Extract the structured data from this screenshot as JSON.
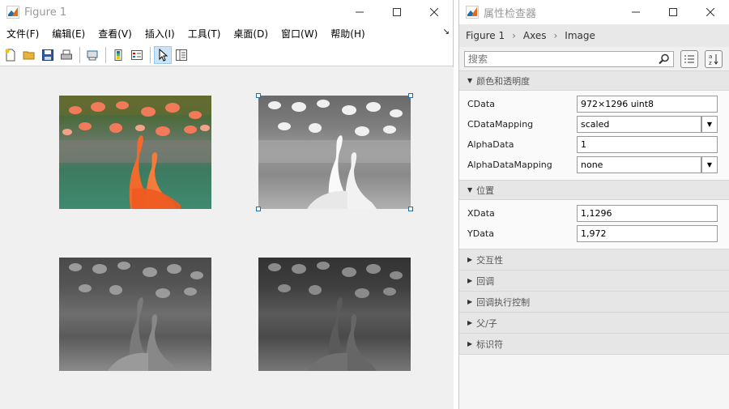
{
  "figure": {
    "title": "Figure 1",
    "menu": [
      "文件(F)",
      "编辑(E)",
      "查看(V)",
      "插入(I)",
      "工具(T)",
      "桌面(D)",
      "窗口(W)",
      "帮助(H)"
    ],
    "dock_glyph": "↘"
  },
  "inspector": {
    "title": "属性检查器",
    "breadcrumbs": [
      "Figure 1",
      "Axes",
      "Image"
    ],
    "search_placeholder": "搜索",
    "sections": {
      "color": "颜色和透明度",
      "position": "位置",
      "interactivity": "交互性",
      "callbacks": "回调",
      "callback_exec": "回调执行控制",
      "parent": "父/子",
      "identifiers": "标识符"
    },
    "props": {
      "cdata": {
        "label": "CData",
        "value": "972×1296 uint8"
      },
      "cdatamapping": {
        "label": "CDataMapping",
        "value": "scaled"
      },
      "alphadata": {
        "label": "AlphaData",
        "value": "1"
      },
      "alphadatamapping": {
        "label": "AlphaDataMapping",
        "value": "none"
      },
      "xdata": {
        "label": "XData",
        "value": "1,1296"
      },
      "ydata": {
        "label": "YData",
        "value": "1,972"
      }
    }
  },
  "colors": {
    "accent": "#0072bd",
    "selection": "#1a6fb0"
  }
}
